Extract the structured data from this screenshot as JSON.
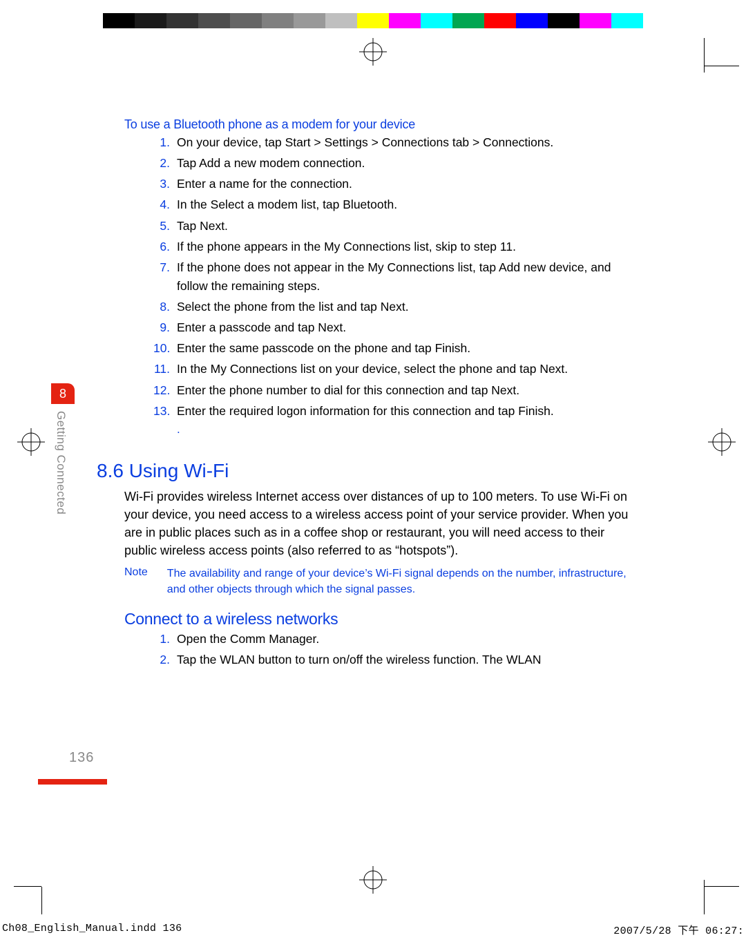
{
  "colorbar": [
    "#ffffff",
    "#000000",
    "#1a1a1a",
    "#333333",
    "#4d4d4d",
    "#666666",
    "#808080",
    "#999999",
    "#bfbfbf",
    "#ffff00",
    "#ff00ff",
    "#00ffff",
    "#00a651",
    "#ff0000",
    "#0000ff",
    "#000000",
    "#ff00ff",
    "#00ffff",
    "#ffffff"
  ],
  "chapter": {
    "number": "8",
    "name": "Getting Connected"
  },
  "page_number": "136",
  "sub1_title": "To use a Bluetooth phone as a modem for your device",
  "steps1": [
    "On your device, tap Start > Settings > Connections tab > Connections.",
    "Tap Add a new modem connection.",
    "Enter a name for the connection.",
    "In the Select a modem list, tap Bluetooth.",
    "Tap Next.",
    "If the phone appears in the My Connections list, skip to step 11.",
    "If the phone does not appear in the My Connections list, tap Add new device, and follow the remaining steps.",
    "Select the phone from the list and tap Next.",
    "Enter a passcode and tap Next.",
    "Enter the same passcode on the phone and tap Finish.",
    "In the My Connections list on your device, select the phone and tap Next.",
    "Enter the phone number to dial for this connection and tap Next.",
    "Enter the required logon information for this connection and tap Finish."
  ],
  "section_title": "8.6 Using Wi-Fi",
  "wifi_body": "Wi-Fi provides wireless Internet access over distances of up to 100 meters. To use Wi-Fi on your device, you need access to a wireless access point of your service provider. When you are in public places such as in a coffee shop or restaurant, you will need access to their public wireless access points (also referred to as “hotspots”).",
  "note_label": "Note",
  "note_text": "The availability and range of your device’s Wi-Fi signal depends on the number, infrastructure, and other objects through which the signal passes.",
  "sub2_title": "Connect to a wireless networks",
  "steps2": [
    "Open the Comm Manager.",
    "Tap the WLAN button to turn on/off the wireless function. The WLAN"
  ],
  "footer": {
    "left": "Ch08_English_Manual.indd   136",
    "right": "2007/5/28   下午 06:27:"
  }
}
